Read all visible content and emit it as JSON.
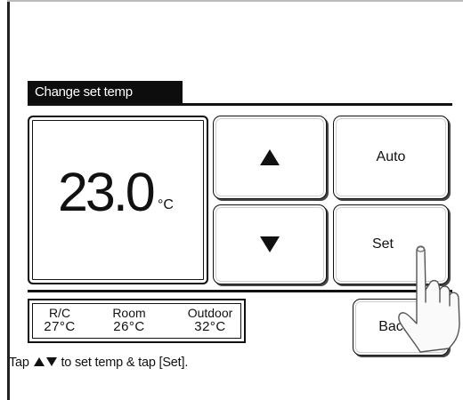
{
  "header": {
    "title": "Change set temp"
  },
  "temperature": {
    "value": "23.0",
    "unit": "°C"
  },
  "buttons": {
    "up_icon": "up-arrow",
    "down_icon": "down-arrow",
    "auto_label": "Auto",
    "set_label": "Set",
    "back_label": "Back"
  },
  "status": {
    "rc_label": "R/C",
    "rc_value": "27°C",
    "room_label": "Room",
    "room_value": "26°C",
    "outdoor_label": "Outdoor",
    "outdoor_value": "32°C"
  },
  "instruction": {
    "prefix": "Tap",
    "suffix": "to set temp & tap [Set]."
  },
  "overlay": {
    "icon": "pointing-hand"
  }
}
